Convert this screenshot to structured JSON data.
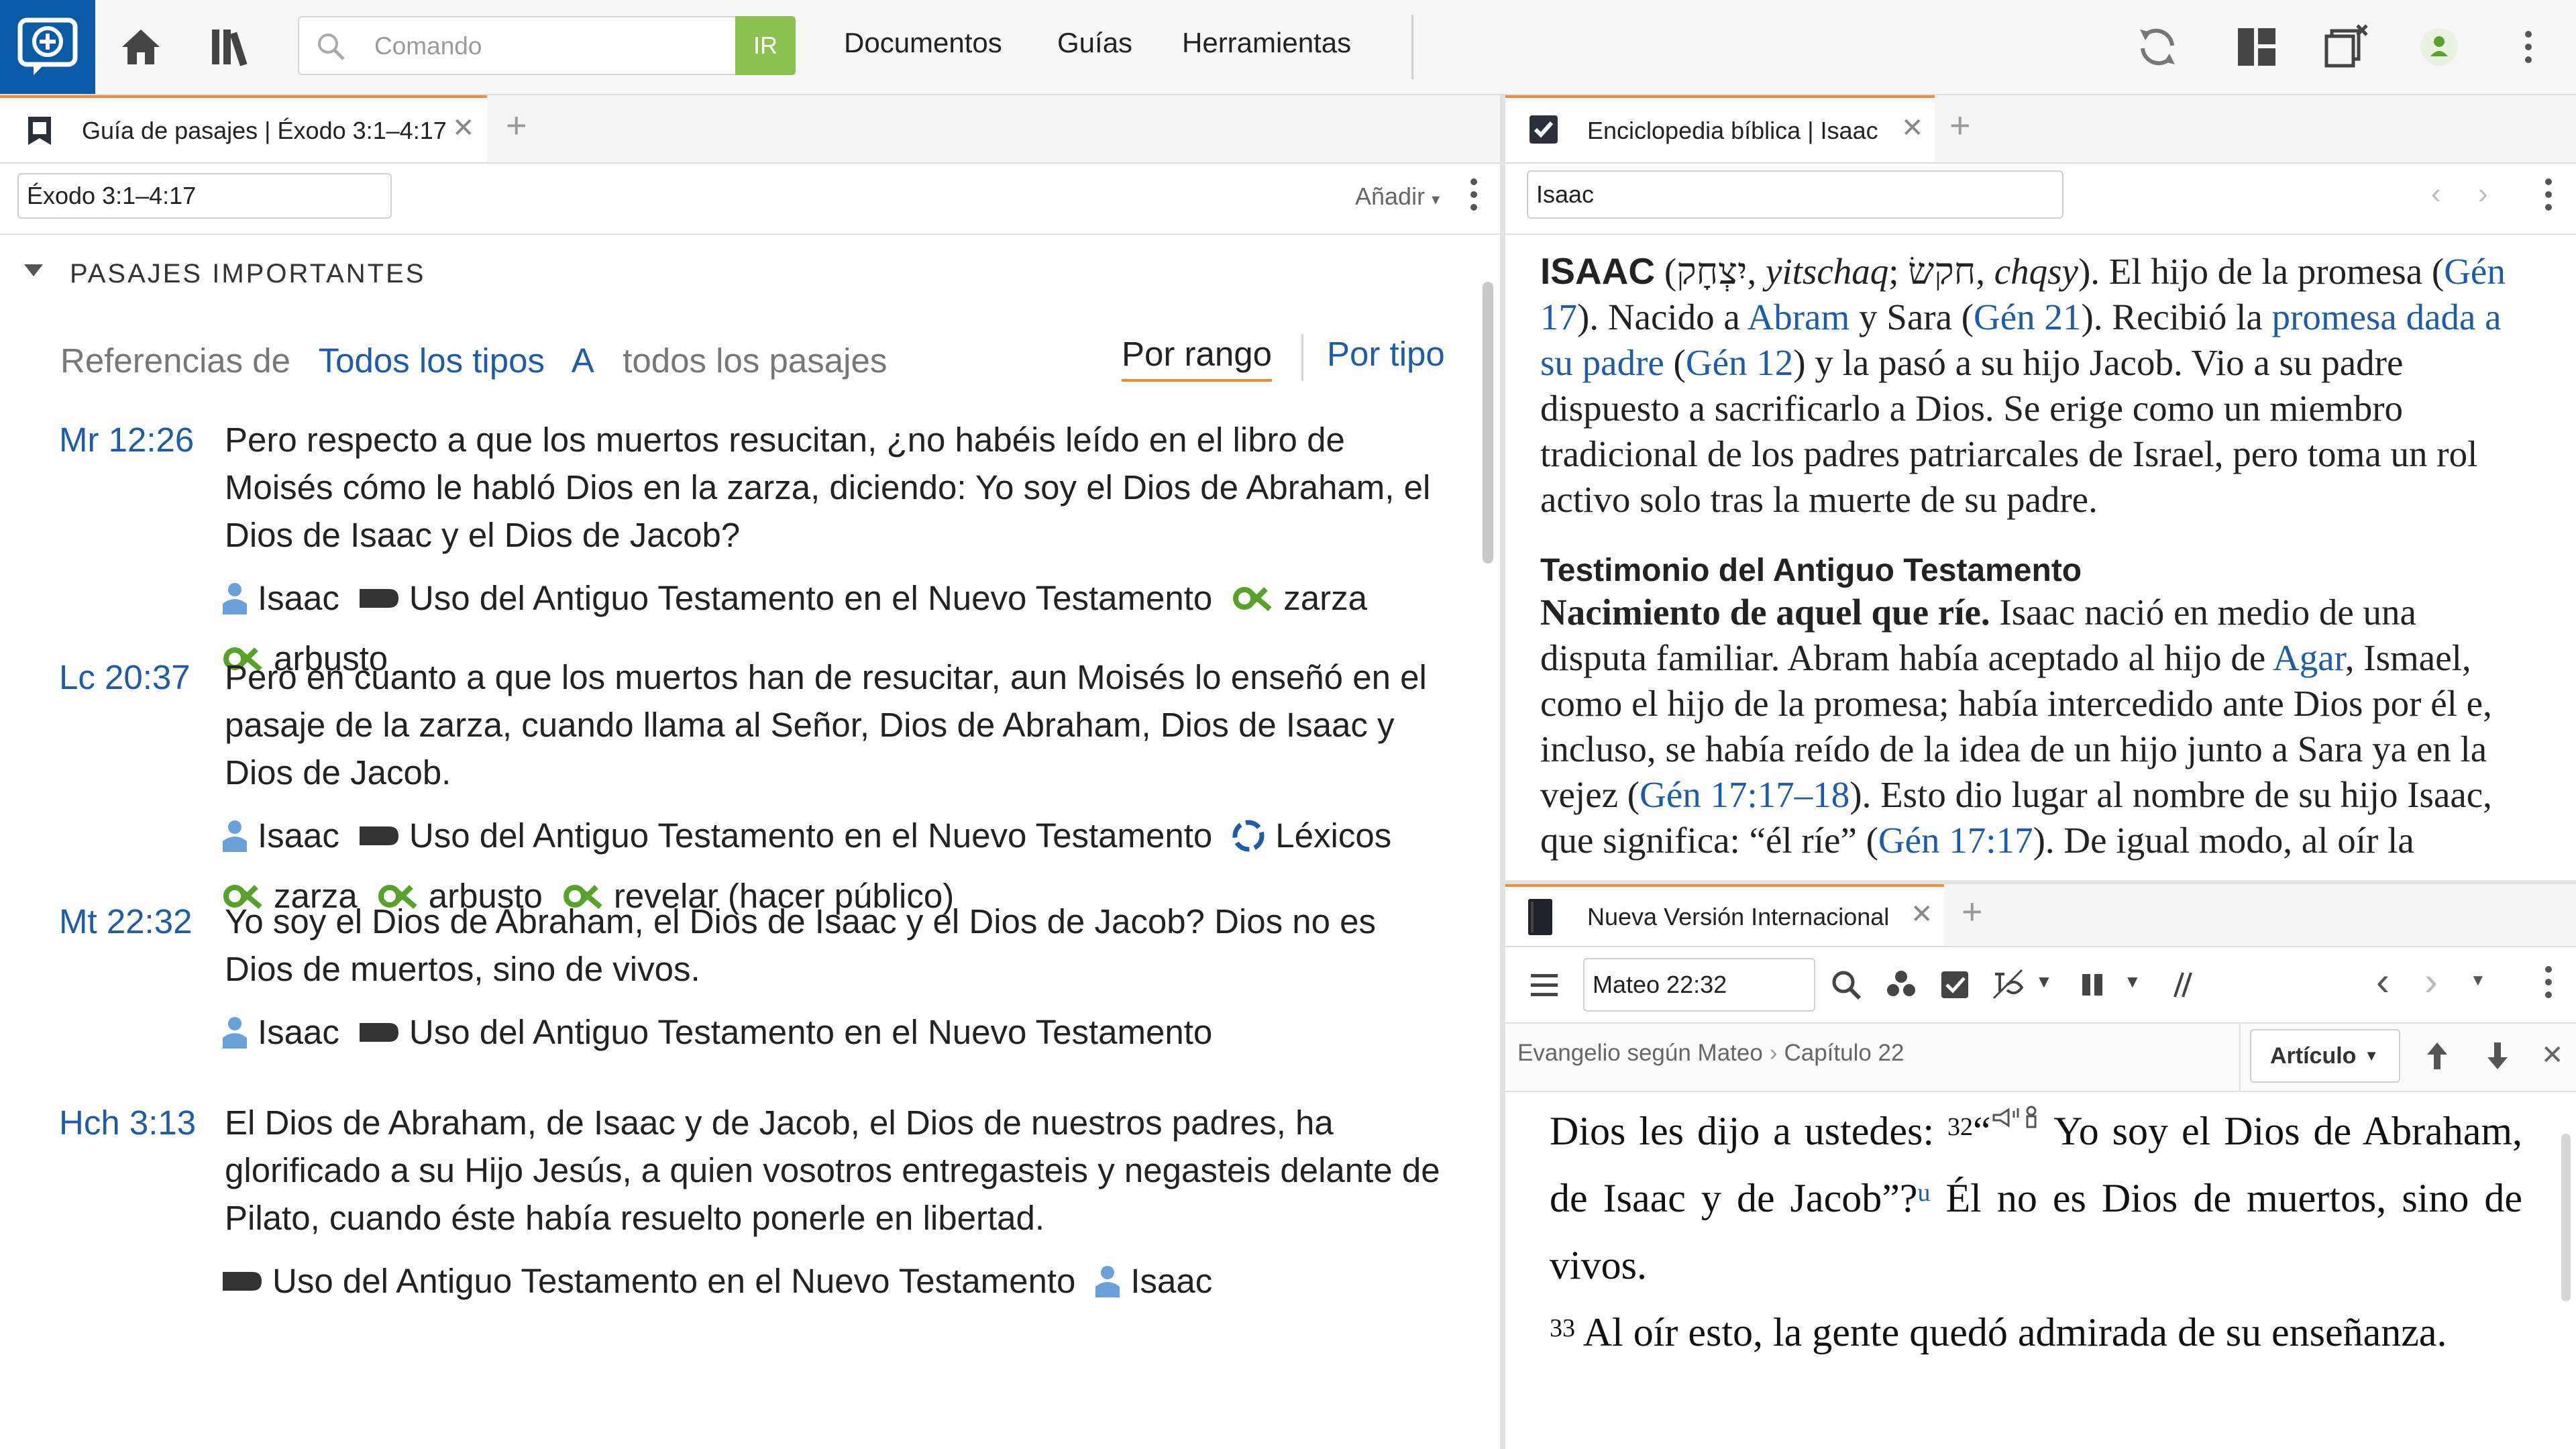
{
  "toolbar": {
    "command_placeholder": "Comando",
    "go_label": "IR",
    "menu": [
      "Documentos",
      "Guías",
      "Herramientas"
    ]
  },
  "left_pane": {
    "tab_label": "Guía de pasajes | Éxodo 3:1–4:17",
    "reference_value": "Éxodo 3:1–4:17",
    "add_label": "Añadir",
    "section_title": "PASAJES IMPORTANTES",
    "refs": {
      "prefix": "Referencias de",
      "types": "Todos los tipos",
      "a": "A",
      "all": "todos los pasajes",
      "by_range": "Por rango",
      "by_type": "Por tipo"
    },
    "passages": [
      {
        "ref": "Mr 12:26",
        "text": "Pero respecto a que los muertos resucitan, ¿no habéis leído en el libro de Moisés cómo le habló Dios en la zarza, diciendo: Yo soy el Dios de Abraham, el Dios de Isaac y el Dios de Jacob?",
        "tags": [
          {
            "kind": "person",
            "label": "Isaac"
          },
          {
            "kind": "label",
            "label": "Uso del Antiguo Testamento en el Nuevo Testamento"
          },
          {
            "kind": "sense",
            "label": "zarza"
          },
          {
            "kind": "sense",
            "label": "arbusto"
          }
        ]
      },
      {
        "ref": "Lc 20:37",
        "text": "Pero en cuanto a que los muertos han de resucitar, aun Moisés lo enseñó en el pasaje de la zarza, cuando llama al Señor, Dios de Abraham, Dios de Isaac y Dios de Jacob.",
        "tags": [
          {
            "kind": "person",
            "label": "Isaac"
          },
          {
            "kind": "label",
            "label": "Uso del Antiguo Testamento en el Nuevo Testamento"
          },
          {
            "kind": "lexicon",
            "label": "Léxicos"
          },
          {
            "kind": "sense",
            "label": "zarza"
          },
          {
            "kind": "sense",
            "label": "arbusto"
          },
          {
            "kind": "sense",
            "label": "revelar (hacer público)"
          }
        ]
      },
      {
        "ref": "Mt 22:32",
        "text": "Yo soy el Dios de Abraham, el Dios de Isaac y el Dios de Jacob? Dios no es Dios de muertos, sino de vivos.",
        "tags": [
          {
            "kind": "person",
            "label": "Isaac"
          },
          {
            "kind": "label",
            "label": "Uso del Antiguo Testamento en el Nuevo Testamento"
          }
        ]
      },
      {
        "ref": "Hch 3:13",
        "text": "El Dios de Abraham, de Isaac y de Jacob, el Dios de nuestros padres, ha glorificado a su Hijo Jesús, a quien vosotros entregasteis y negasteis delante de Pilato, cuando éste había resuelto ponerle en libertad.",
        "tags": [
          {
            "kind": "label",
            "label": "Uso del Antiguo Testamento en el Nuevo Testamento"
          },
          {
            "kind": "person",
            "label": "Isaac"
          }
        ]
      }
    ]
  },
  "encyclopedia": {
    "tab_label": "Enciclopedia bíblica | Isaac",
    "search_value": "Isaac",
    "headword": "ISAAC",
    "open_paren": " (",
    "hebrew1": "יִצְחָק",
    "translit1": "yitschaq",
    "semi": "; ",
    "hebrew2": "חקשׂ",
    "translit2": "chqsy",
    "p1_a": "). El hijo de la promesa (",
    "link_gen17": "Gén 17",
    "p1_b": "). Nacido a ",
    "link_abram": "Abram",
    "p1_c": " y Sara (",
    "link_gen21": "Gén 21",
    "p1_d": "). Recibió la ",
    "link_promise": "promesa dada a su padre",
    "p1_e": " (",
    "link_gen12": "Gén 12",
    "p1_f": ") y la pasó a su hijo Jacob. Vio a su padre dispuesto a sacrificarlo a Dios. Se erige como un miembro tradicional de los padres patriarcales de Israel, pero toma un rol activo solo tras la muerte de su padre.",
    "subheading": "Testimonio del Antiguo Testamento",
    "p2_bold": "Nacimiento de aquel que ríe.",
    "p2_a": " Isaac nació en medio de una disputa familiar. Abram había aceptado al hijo de ",
    "link_agar": "Agar",
    "p2_b": ", Ismael, como el hijo de la promesa; había intercedido ante Dios por él e, incluso, se había reído de la idea de un hijo junto a Sara ya en la vejez (",
    "link_gen1717": "Gén 17:17–18",
    "p2_c": "). Esto dio lugar al nombre de su hijo Isaac, que significa: “él ríe” (",
    "link_gen1717b": "Gén 17:17",
    "p2_d": "). De igual modo, al oír la"
  },
  "bible": {
    "tab_label": "Nueva Versión Internacional",
    "reference_value": "Mateo 22:32",
    "breadcrumb_book": "Evangelio según Mateo",
    "breadcrumb_chapter": "Capítulo 22",
    "article_label": "Artículo",
    "text_a": "Dios les dijo a ustedes: ",
    "v32": "32",
    "text_b": "“",
    "text_c": " Yo soy el Dios de Abraham, de Isaac y de Jacob”?",
    "xref": "u",
    "text_d": " Él no es Dios de muertos, sino de vivos.",
    "v33": "33",
    "text_e": " Al oír esto, la gente quedó admirada de su enseñanza."
  },
  "colors": {
    "accent_orange": "#f08a3c",
    "link_blue": "#1f5ba8",
    "go_green": "#8cc152",
    "brand_blue": "#0b5aa8",
    "tag_green": "#5aa02c",
    "person_blue": "#6a9fd8"
  }
}
